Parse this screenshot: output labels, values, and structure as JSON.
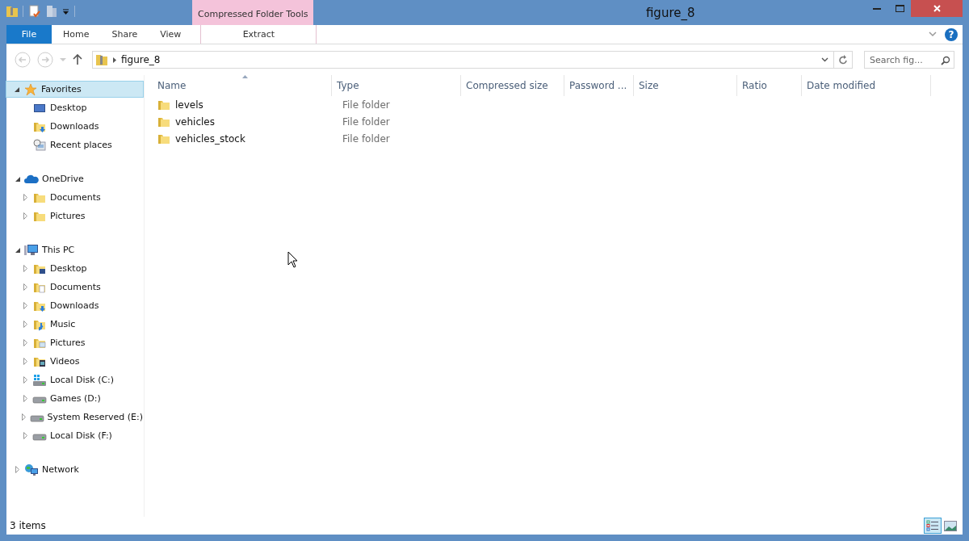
{
  "window": {
    "title": "figure_8"
  },
  "ribbon": {
    "contextual_label": "Compressed Folder Tools",
    "help_label": "?",
    "tabs": [
      {
        "label": "File",
        "kind": "file"
      },
      {
        "label": "Home",
        "kind": "normal"
      },
      {
        "label": "Share",
        "kind": "normal"
      },
      {
        "label": "View",
        "kind": "normal"
      },
      {
        "label": "Extract",
        "kind": "contextual"
      }
    ]
  },
  "address": {
    "path": [
      "figure_8"
    ],
    "search_placeholder": "Search fig..."
  },
  "nav": [
    {
      "label": "Favorites",
      "kind": "star",
      "expanded": true,
      "selected": true,
      "children": [
        {
          "label": "Desktop",
          "kind": "desktop",
          "selected": false
        },
        {
          "label": "Downloads",
          "kind": "downloads",
          "selected": false
        },
        {
          "label": "Recent places",
          "kind": "recent",
          "selected": false
        }
      ]
    },
    {
      "label": "OneDrive",
      "kind": "cloud",
      "expanded": true,
      "selected": false,
      "children": [
        {
          "label": "Documents",
          "kind": "folder",
          "expanded": false,
          "selected": false
        },
        {
          "label": "Pictures",
          "kind": "folder",
          "expanded": false,
          "selected": false
        }
      ]
    },
    {
      "label": "This PC",
      "kind": "pc",
      "expanded": true,
      "selected": false,
      "children": [
        {
          "label": "Desktop",
          "kind": "desktop-folder",
          "expanded": false,
          "selected": false
        },
        {
          "label": "Documents",
          "kind": "documents",
          "expanded": false,
          "selected": false
        },
        {
          "label": "Downloads",
          "kind": "downloads",
          "expanded": false,
          "selected": false
        },
        {
          "label": "Music",
          "kind": "music",
          "expanded": false,
          "selected": false
        },
        {
          "label": "Pictures",
          "kind": "pictures",
          "expanded": false,
          "selected": false
        },
        {
          "label": "Videos",
          "kind": "videos",
          "expanded": false,
          "selected": false
        },
        {
          "label": "Local Disk (C:)",
          "kind": "system-drive",
          "expanded": false,
          "selected": false
        },
        {
          "label": "Games (D:)",
          "kind": "drive",
          "expanded": false,
          "selected": false
        },
        {
          "label": "System Reserved (E:)",
          "kind": "drive",
          "expanded": false,
          "selected": false
        },
        {
          "label": "Local Disk (F:)",
          "kind": "drive",
          "expanded": false,
          "selected": false
        }
      ]
    },
    {
      "label": "Network",
      "kind": "network",
      "expanded": false,
      "selected": false
    }
  ],
  "table": {
    "columns": [
      {
        "label": "Name",
        "sorted": true
      },
      {
        "label": "Type",
        "sorted": false
      },
      {
        "label": "Compressed size",
        "sorted": false
      },
      {
        "label": "Password ...",
        "sorted": false
      },
      {
        "label": "Size",
        "sorted": false
      },
      {
        "label": "Ratio",
        "sorted": false
      },
      {
        "label": "Date modified",
        "sorted": false
      }
    ],
    "rows": [
      {
        "name": "levels",
        "type": "File folder"
      },
      {
        "name": "vehicles",
        "type": "File folder"
      },
      {
        "name": "vehicles_stock",
        "type": "File folder"
      }
    ]
  },
  "status_bar": {
    "text": "3 items",
    "views": [
      {
        "kind": "details",
        "selected": true
      },
      {
        "kind": "large-icons",
        "selected": false
      }
    ]
  }
}
